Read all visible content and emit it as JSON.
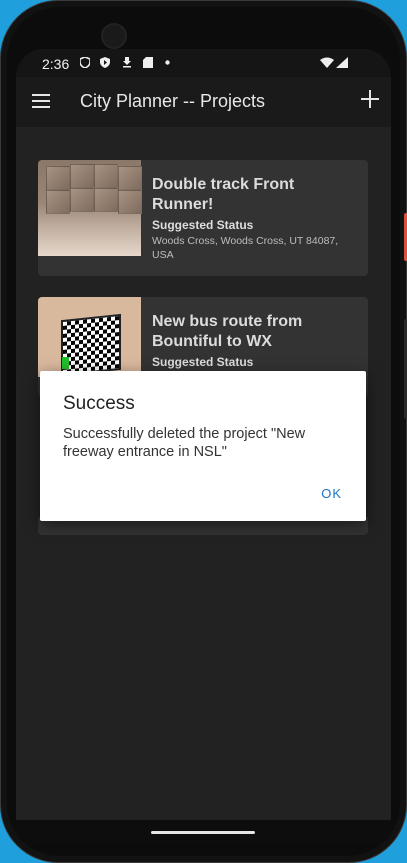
{
  "statusbar": {
    "time": "2:36",
    "icons": [
      "shield-icon",
      "play-icon",
      "download-icon",
      "sd-card-icon",
      "dot-icon",
      "wifi-icon",
      "signal-icon"
    ]
  },
  "appbar": {
    "title": "City Planner -- Projects",
    "menu_icon": "hamburger-menu-icon",
    "add_icon": "plus-icon"
  },
  "projects": [
    {
      "name": "Double track Front Runner!",
      "status": "Suggested Status",
      "address": "Woods Cross, Woods Cross, UT 84087, USA"
    },
    {
      "name": "New bus route from Bountiful to WX",
      "status": "Suggested Status"
    }
  ],
  "dialog": {
    "title": "Success",
    "message": "Successfully deleted the project \"New freeway entrance in NSL\"",
    "ok_label": "OK"
  },
  "colors": {
    "accent": "#1b74c5",
    "background": "#222222",
    "card": "#333333",
    "device_frame": "#1fa0dc"
  }
}
